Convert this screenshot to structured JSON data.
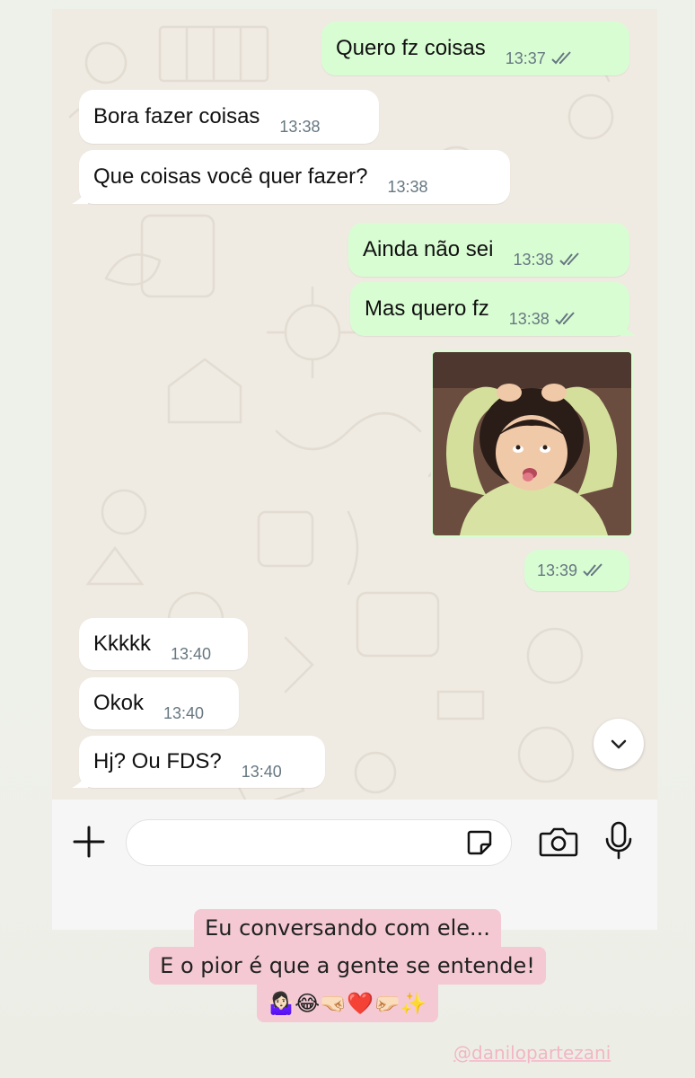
{
  "chat": {
    "messages": [
      {
        "text": "Quero fz coisas",
        "time": "13:37",
        "dir": "out"
      },
      {
        "text": "Bora fazer coisas",
        "time": "13:38",
        "dir": "in"
      },
      {
        "text": "Que coisas você quer fazer?",
        "time": "13:38",
        "dir": "in"
      },
      {
        "text": "Ainda não sei",
        "time": "13:38",
        "dir": "out"
      },
      {
        "text": "Mas quero fz",
        "time": "13:38",
        "dir": "out"
      },
      {
        "text": "",
        "time": "13:39",
        "dir": "out"
      },
      {
        "text": "Kkkkk",
        "time": "13:40",
        "dir": "in"
      },
      {
        "text": "Okok",
        "time": "13:40",
        "dir": "in"
      },
      {
        "text": "Hj? Ou FDS?",
        "time": "13:40",
        "dir": "in"
      }
    ]
  },
  "caption": {
    "line1": "Eu conversando com ele...",
    "line2": "E o pior é que a gente se entende!",
    "emojis": "🤷🏻‍♀️😂🤜🏻❤️🤛🏻✨"
  },
  "watermark": "@danilopartezani",
  "icons": {
    "plus": "plus-icon",
    "sticker": "sticker-icon",
    "camera": "camera-icon",
    "mic": "mic-icon",
    "scroll": "chevron-down-icon",
    "ticks": "double-check-icon"
  },
  "colors": {
    "outgoing_bubble": "#d9fdd3",
    "incoming_bubble": "#ffffff",
    "read_ticks": "#53bdeb",
    "caption_bg": "#f4c9d3"
  }
}
